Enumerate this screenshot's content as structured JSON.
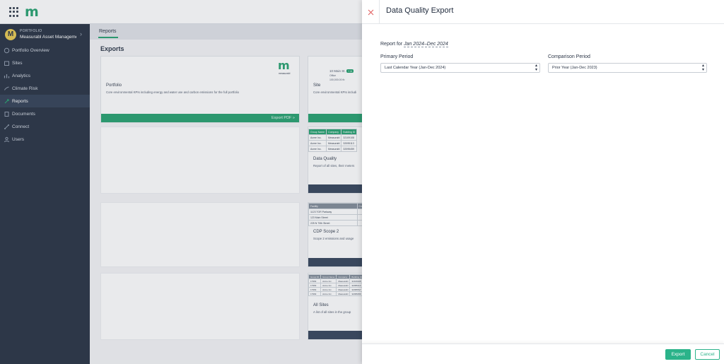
{
  "app": {
    "logo": "m"
  },
  "sidebar": {
    "portfolio_tag": "PORTFOLIO",
    "avatar_letter": "M",
    "portfolio_name": "Measurabl Asset Manageme",
    "items": [
      {
        "label": "Portfolio Overview",
        "icon": "overview-icon"
      },
      {
        "label": "Sites",
        "icon": "sites-icon"
      },
      {
        "label": "Analytics",
        "icon": "analytics-icon"
      },
      {
        "label": "Climate Risk",
        "icon": "climate-icon"
      },
      {
        "label": "Reports",
        "icon": "reports-icon",
        "active": true
      },
      {
        "label": "Documents",
        "icon": "documents-icon"
      },
      {
        "label": "Connect",
        "icon": "connect-icon"
      },
      {
        "label": "Users",
        "icon": "users-icon"
      }
    ]
  },
  "main": {
    "tab": "Reports",
    "section_title": "Exports",
    "cards": {
      "portfolio": {
        "title": "Portfolio",
        "desc": "Core environmental KPIs including energy and water use and carbon emissions for the full portfolio",
        "action": "Export PDF »",
        "logo": "m",
        "logo_sub": "measurabl"
      },
      "site": {
        "title": "Site",
        "desc": "Core environmental KPIs includi",
        "address": "10 Main St.",
        "badge": "+ A",
        "sub1": "Office",
        "sub2": "100,000.00 ft²"
      },
      "data_quality": {
        "title": "Data Quality",
        "desc": "Report of all sites, their meters",
        "headers": [
          "Group Name",
          "Company",
          "Building ID"
        ],
        "rows": [
          [
            "Acme Inc.",
            "Measurabl",
            "32109108"
          ],
          [
            "Acme Inc.",
            "Measurabl",
            "32095113"
          ],
          [
            "Acme Inc.",
            "Measurabl",
            "32095459"
          ]
        ]
      },
      "cdp": {
        "title": "CDP Scope 2",
        "desc": "Scope 2 emissions and usage",
        "headers": [
          "Facility",
          "Co"
        ],
        "rows": [
          [
            "1123 TOR Parkway",
            ""
          ],
          [
            "123 Main Street",
            ""
          ],
          [
            "225 N 70th Street",
            ""
          ]
        ]
      },
      "all_sites": {
        "title": "All Sites",
        "desc": "A list of all sites in the group",
        "headers": [
          "Group ID",
          "Group Name",
          "Company",
          "Building ID"
        ],
        "rows": [
          [
            "17963",
            "Acme Inc.",
            "Measurabl",
            "32109108"
          ],
          [
            "17963",
            "Acme Inc.",
            "Measurabl",
            "32095113"
          ],
          [
            "17963",
            "Acme Inc.",
            "Measurabl",
            "32095517"
          ],
          [
            "17963",
            "Acme Inc.",
            "Measurabl",
            "32095459"
          ]
        ]
      }
    }
  },
  "drawer": {
    "title": "Data Quality Export",
    "report_for_label": "Report for",
    "report_for_value": "Jan 2024–Dec 2024",
    "primary_label": "Primary Period",
    "primary_value": "Last Calendar Year (Jan-Dec 2024)",
    "comparison_label": "Comparison Period",
    "comparison_value": "Prior Year (Jan-Dec 2023)",
    "export_label": "Export",
    "cancel_label": "Cancel"
  },
  "colors": {
    "accent": "#1e9e6a",
    "sidebar": "#1f2a3c",
    "button": "#2bb38a",
    "close": "#e05a5a"
  }
}
